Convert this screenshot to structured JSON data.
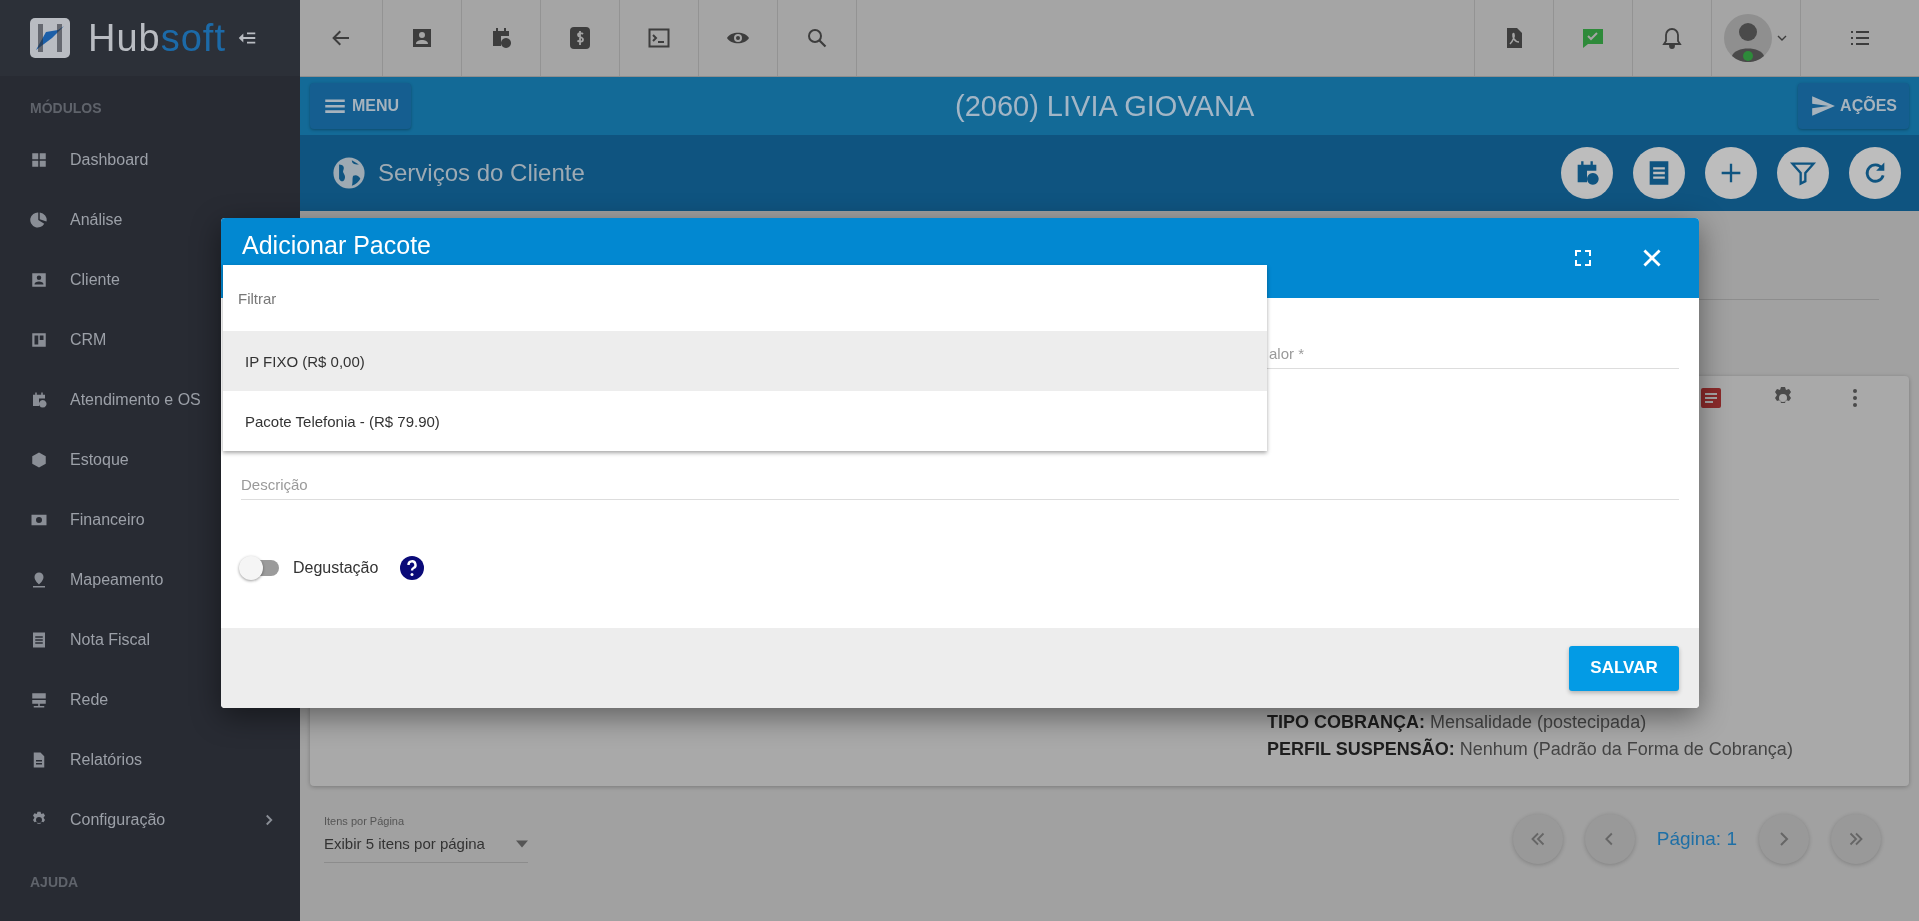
{
  "brand": {
    "part_a": "Hub",
    "part_b": "soft"
  },
  "sidebar": {
    "sections": [
      {
        "title": "MÓDULOS",
        "items": [
          {
            "label": "Dashboard",
            "expandable": false
          },
          {
            "label": "Análise",
            "expandable": false
          },
          {
            "label": "Cliente"
          },
          {
            "label": "CRM"
          },
          {
            "label": "Atendimento e OS"
          },
          {
            "label": "Estoque"
          },
          {
            "label": "Financeiro"
          },
          {
            "label": "Mapeamento"
          },
          {
            "label": "Nota Fiscal"
          },
          {
            "label": "Rede"
          },
          {
            "label": "Relatórios",
            "expandable": false
          },
          {
            "label": "Configuração",
            "expandable": true
          }
        ]
      },
      {
        "title": "AJUDA"
      }
    ]
  },
  "header": {
    "menu_button": "MENU",
    "title": "(2060) LIVIA GIOVANA",
    "actions_button": "AÇÕES"
  },
  "section": {
    "title": "Serviços do Cliente"
  },
  "card": {
    "lines": [
      {
        "label": "TIPO COBRANÇA:",
        "value": "Mensalidade (postecipada)"
      },
      {
        "label": "PERFIL SUSPENSÃO:",
        "value": "Nenhum (Padrão da Forma de Cobrança)"
      }
    ]
  },
  "pagination": {
    "per_page_label": "Itens por Página",
    "per_page_value": "Exibir 5 itens por página",
    "page": "Página: 1"
  },
  "modal": {
    "title": "Adicionar Pacote",
    "dropdown": {
      "placeholder": "Filtrar",
      "options": [
        {
          "label": "IP FIXO (R$ 0,00)",
          "selected": true
        },
        {
          "label": "Pacote Telefonia - (R$ 79.90)",
          "selected": false
        }
      ]
    },
    "value_label": "alor *",
    "description_placeholder": "Descrição",
    "toggle": {
      "label": "Degustação",
      "on": false
    },
    "save_button": "SALVAR"
  }
}
